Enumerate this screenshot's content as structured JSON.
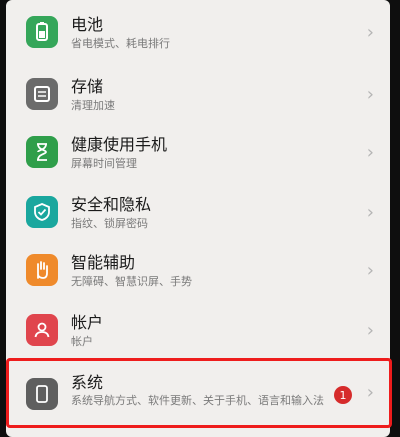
{
  "settings": {
    "items": [
      {
        "title": "电池",
        "subtitle": "省电模式、耗电排行",
        "icon": "battery-icon",
        "color": "#35a65a"
      },
      {
        "title": "存储",
        "subtitle": "清理加速",
        "icon": "storage-icon",
        "color": "#6b6b6b"
      },
      {
        "title": "健康使用手机",
        "subtitle": "屏幕时间管理",
        "icon": "hourglass-icon",
        "color": "#2f9e4a"
      },
      {
        "title": "安全和隐私",
        "subtitle": "指纹、锁屏密码",
        "icon": "shield-icon",
        "color": "#1aa79e"
      },
      {
        "title": "智能辅助",
        "subtitle": "无障碍、智慧识屏、手势",
        "icon": "hand-icon",
        "color": "#ef8a2b"
      },
      {
        "title": "帐户",
        "subtitle": "帐户",
        "icon": "account-icon",
        "color": "#e0454d"
      },
      {
        "title": "系统",
        "subtitle": "系统导航方式、软件更新、关于手机、语言和输入法",
        "icon": "phone-icon",
        "color": "#5f5f5f",
        "badge": "1"
      }
    ]
  },
  "highlight_color": "#ee1c1c"
}
